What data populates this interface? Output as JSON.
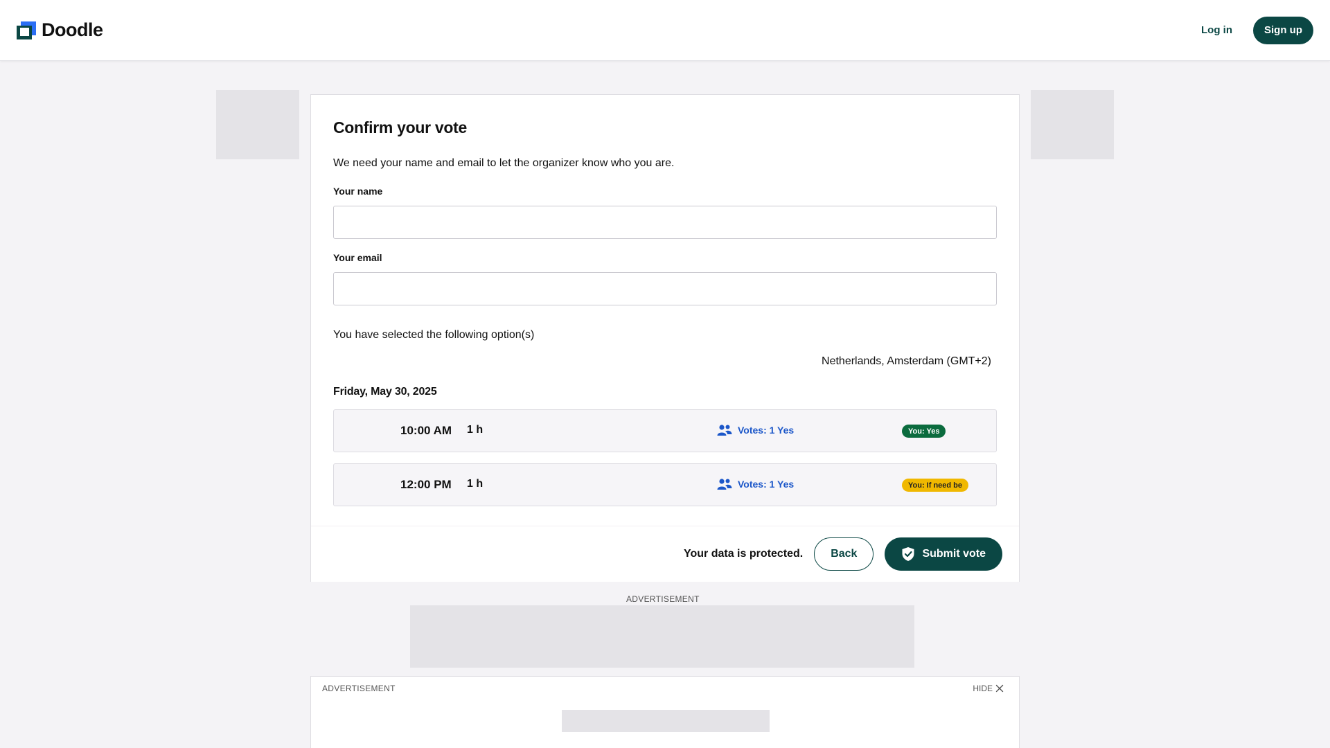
{
  "header": {
    "logo_text": "Doodle",
    "login_label": "Log in",
    "signup_label": "Sign up"
  },
  "form": {
    "title": "Confirm your vote",
    "subtitle": "We need your name and email to let the organizer know who you are.",
    "name_label": "Your name",
    "name_value": "",
    "email_label": "Your email",
    "email_value": "",
    "options_text": "You have selected the following option(s)",
    "timezone": "Netherlands, Amsterdam (GMT+2)",
    "date": "Friday, May 30, 2025",
    "slots": [
      {
        "time": "10:00 AM",
        "duration": "1 h",
        "votes": "Votes: 1 Yes",
        "you": "You: Yes"
      },
      {
        "time": "12:00 PM",
        "duration": "1 h",
        "votes": "Votes: 1 Yes",
        "you": "You: If need be"
      }
    ]
  },
  "footer": {
    "protected_text": "Your data is protected.",
    "back_label": "Back",
    "submit_label": "Submit vote"
  },
  "ads": {
    "label": "ADVERTISEMENT",
    "hide_label": "HIDE"
  },
  "colors": {
    "brand": "#0b4744",
    "accent_blue": "#1c57c9",
    "yes_badge": "#0b6b3e",
    "maybe_badge": "#f0b800"
  },
  "icons": {
    "votes": "people-icon",
    "submit": "shield-check-icon",
    "hide": "close-icon"
  }
}
